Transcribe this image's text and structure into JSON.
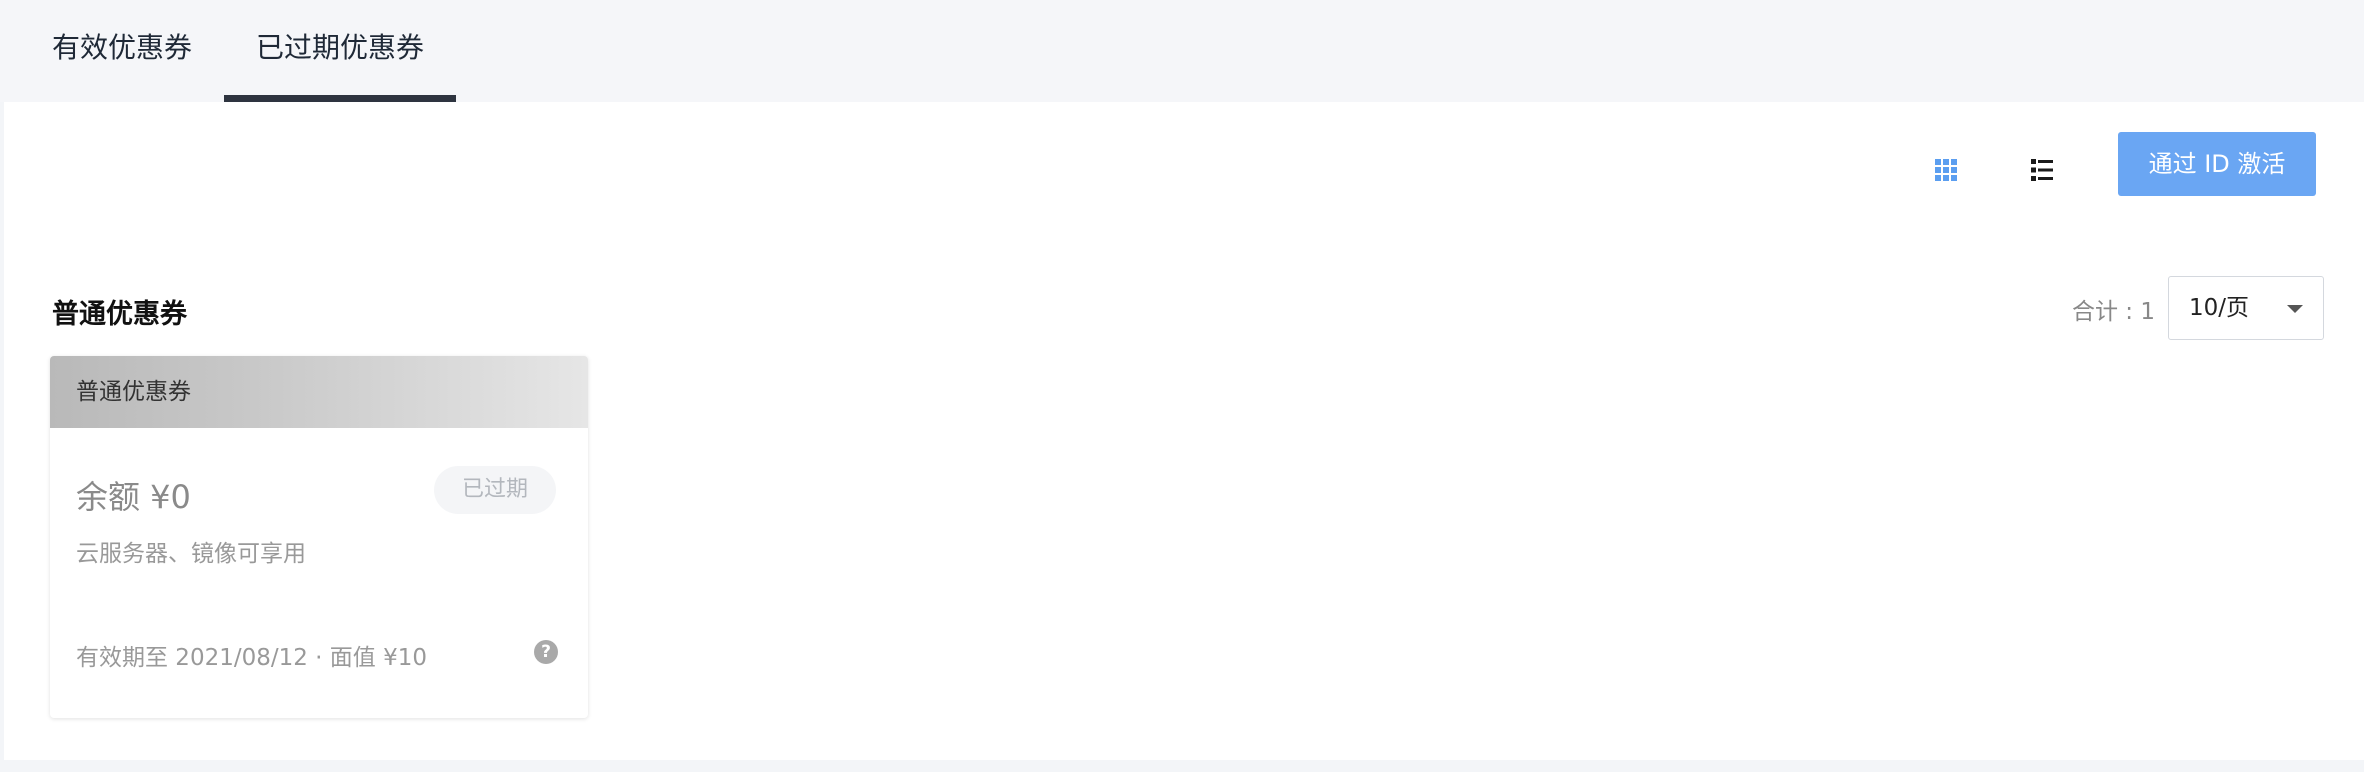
{
  "tabs": [
    {
      "label": "有效优惠券",
      "active": false
    },
    {
      "label": "已过期优惠券",
      "active": true
    }
  ],
  "toolbar": {
    "grid_view_icon": "grid-icon",
    "list_view_icon": "list-icon",
    "activate_label": "通过 ID 激活"
  },
  "section": {
    "title": "普通优惠券",
    "total_label": "合计 : 1",
    "page_size": "10/页"
  },
  "coupon": {
    "header": "普通优惠券",
    "balance": "余额 ¥0",
    "status": "已过期",
    "scope": "云服务器、镜像可享用",
    "validity": "有效期至 2021/08/12 · 面值 ¥10",
    "help": "?"
  },
  "colors": {
    "accent": "#6aa6f3",
    "tab_underline": "#2e3440",
    "page_bg": "#f3f5f8"
  }
}
